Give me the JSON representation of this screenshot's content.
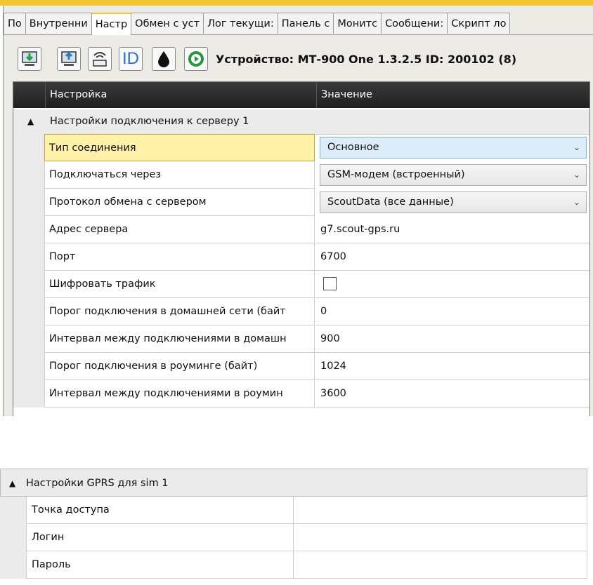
{
  "tabs": [
    "По",
    "Внутренни",
    "Настр",
    "Обмен с уст",
    "Лог текущи:",
    "Панель с",
    "Монитс",
    "Сообщени:",
    "Скрипт ло"
  ],
  "active_tab_index": 2,
  "toolbar": {
    "icons": [
      "download-to-device-icon",
      "upload-from-device-icon",
      "wireless-device-icon",
      "id-icon",
      "drop-icon",
      "play-icon"
    ],
    "id_label": "ID",
    "device_label": "Устройство: МТ-900 One 1.3.2.5 ID: 200102 (8)"
  },
  "grid": {
    "header_name": "Настройка",
    "header_value": "Значение",
    "group_label": "Настройки подключения к серверу 1",
    "rows": [
      {
        "name": "Тип соединения",
        "value": "Основное",
        "kind": "combo"
      },
      {
        "name": "Подключаться через",
        "value": "GSM-модем (встроенный)",
        "kind": "combo"
      },
      {
        "name": "Протокол обмена с сервером",
        "value": "ScoutData (все данные)",
        "kind": "combo"
      },
      {
        "name": "Адрес сервера",
        "value": "g7.scout-gps.ru",
        "kind": "text"
      },
      {
        "name": "Порт",
        "value": "6700",
        "kind": "text"
      },
      {
        "name": "Шифровать трафик",
        "value": "",
        "kind": "checkbox"
      },
      {
        "name": "Порог подключения в домашней сети (байт",
        "value": "0",
        "kind": "text"
      },
      {
        "name": "Интервал между подключениями в домашн",
        "value": "900",
        "kind": "text"
      },
      {
        "name": "Порог подключения в роуминге (байт)",
        "value": "1024",
        "kind": "text"
      },
      {
        "name": "Интервал между подключениями в роумин",
        "value": "3600",
        "kind": "text"
      }
    ]
  },
  "gprs": {
    "group_label": "Настройки GPRS для sim 1",
    "rows": [
      {
        "name": "Точка доступа",
        "value": ""
      },
      {
        "name": "Логин",
        "value": ""
      },
      {
        "name": "Пароль",
        "value": ""
      }
    ]
  },
  "colors": {
    "accent": "#f4c531",
    "selected_row": "#fff1a8",
    "header_bg": "#2a2a2a",
    "focus_combo": "#ddecf9"
  }
}
